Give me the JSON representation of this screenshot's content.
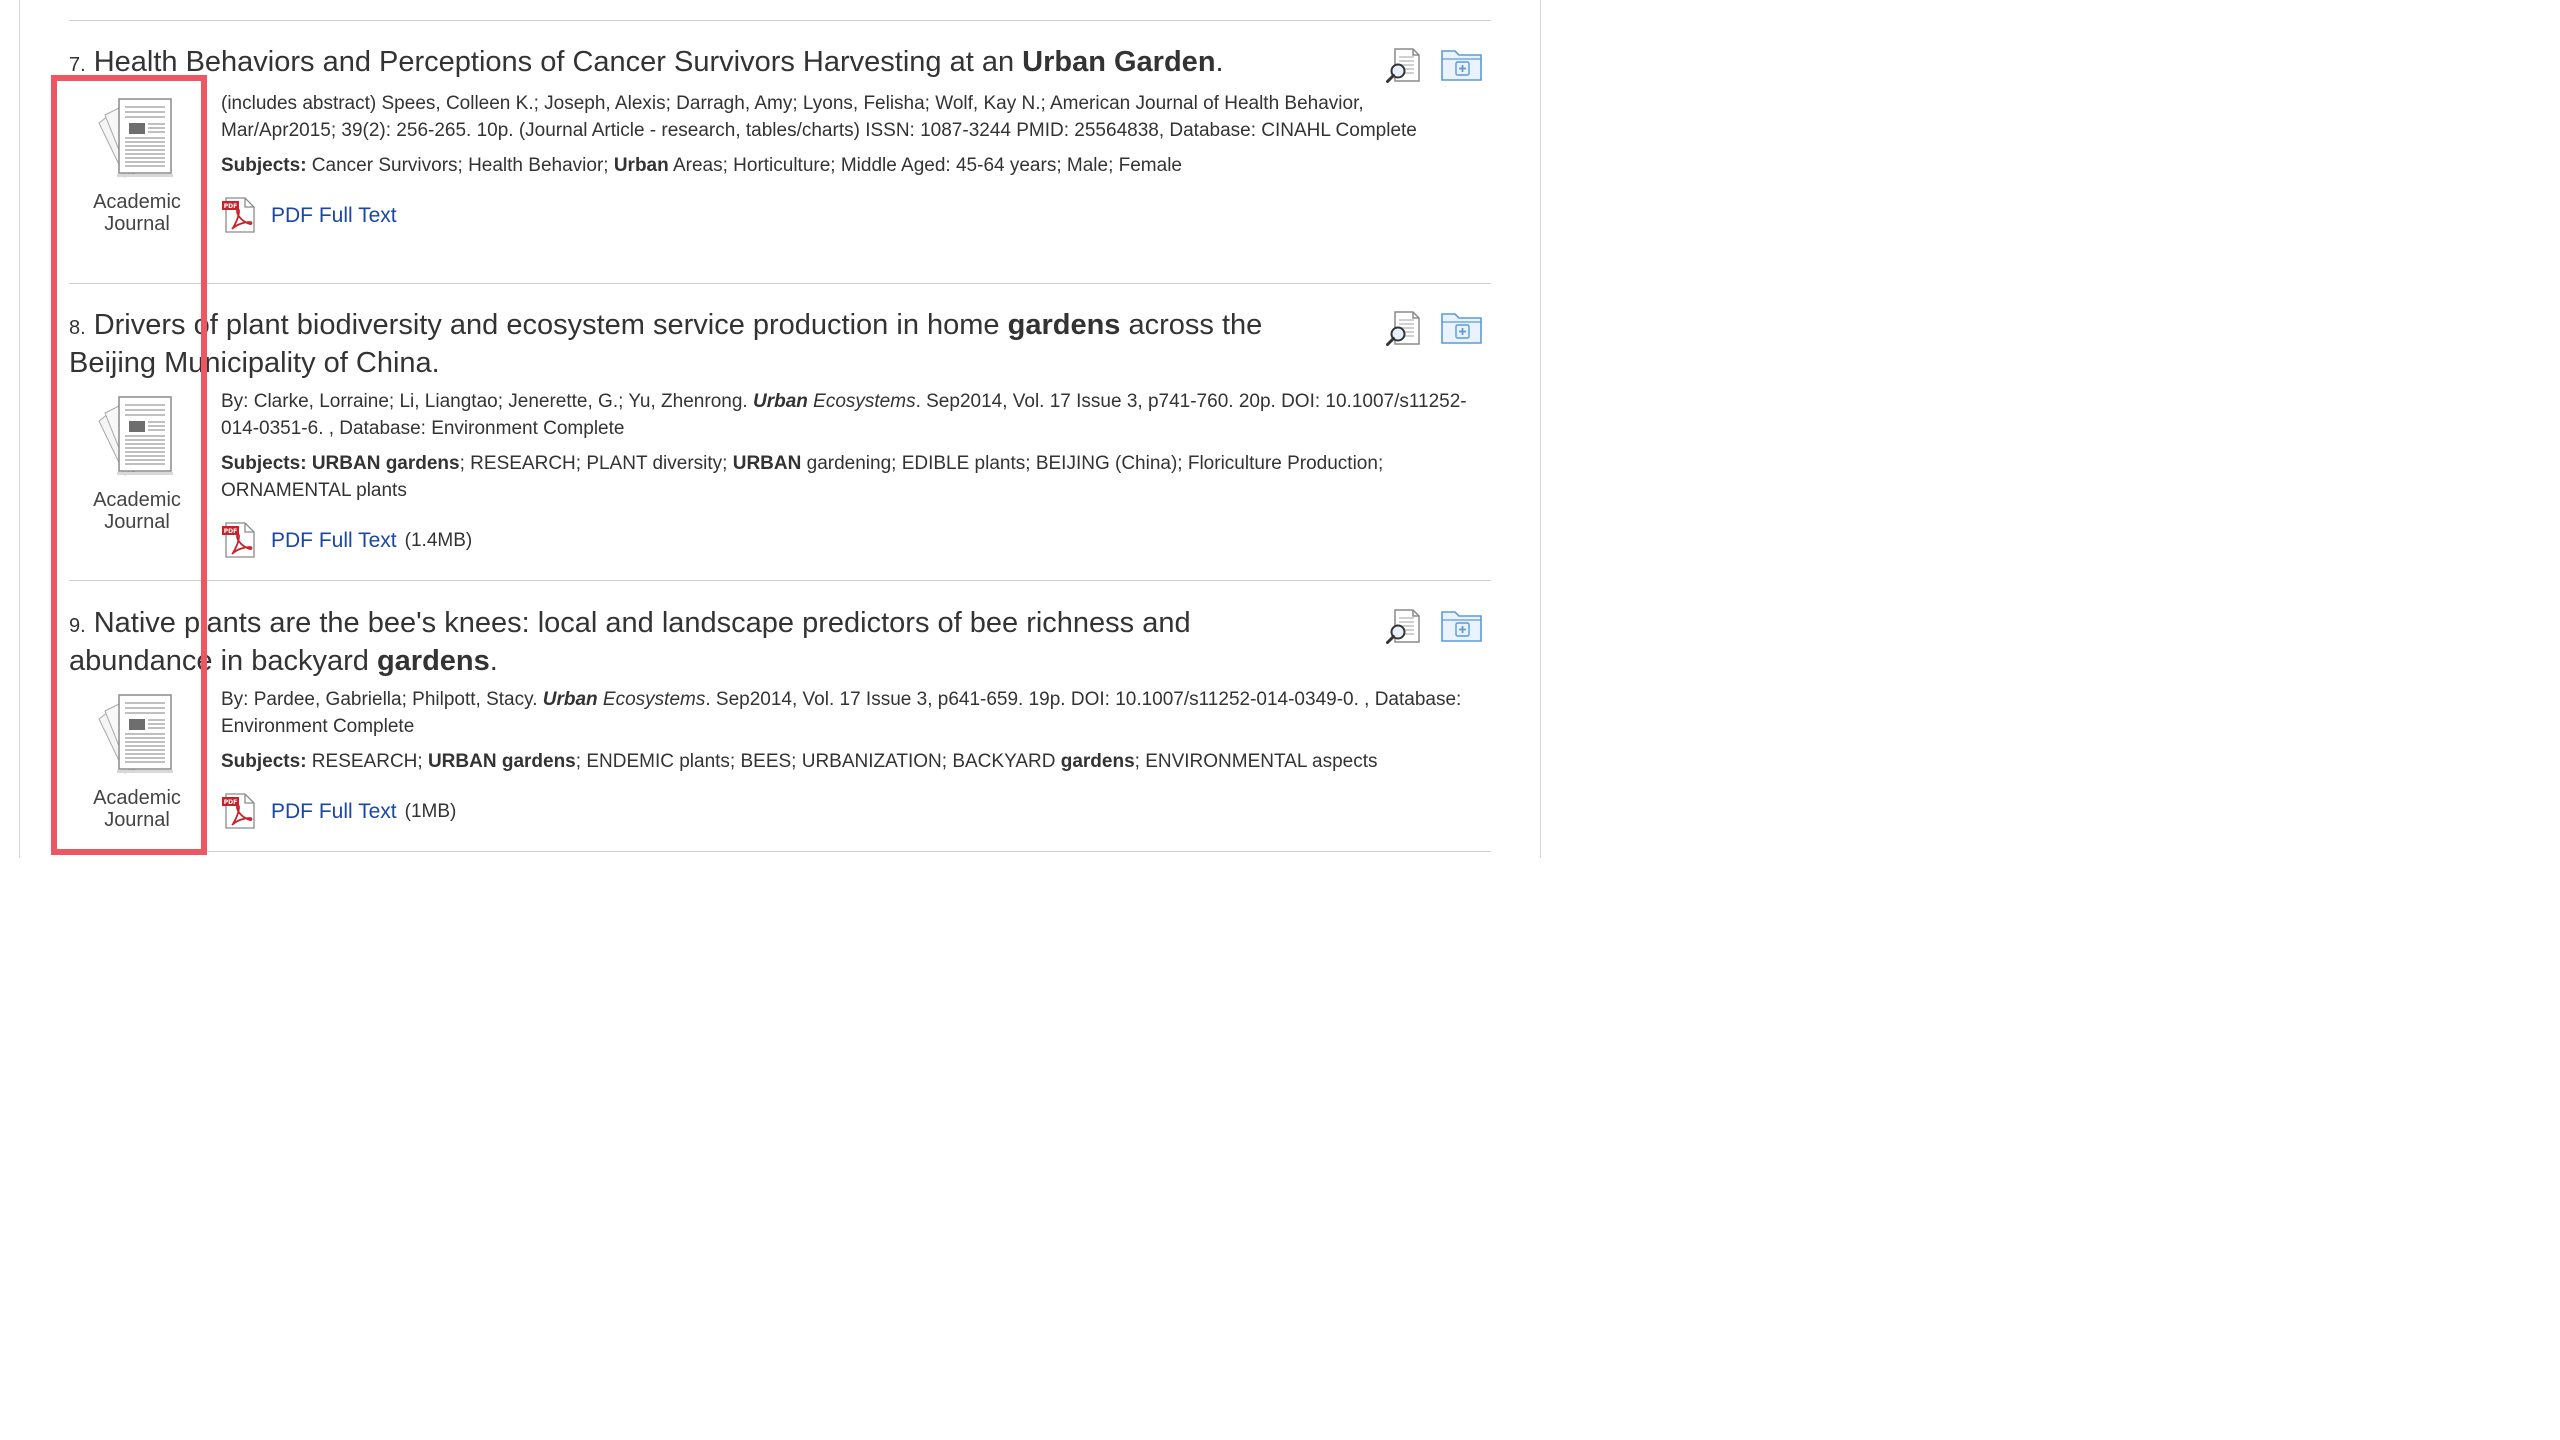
{
  "results": [
    {
      "number": "7.",
      "title_parts": [
        "Health Behaviors and Perceptions of Cancer Survivors Harvesting at an ",
        "Urban Garden",
        "."
      ],
      "publication_type": "Academic Journal",
      "citation": {
        "text": "(includes abstract) Spees, Colleen K.; Joseph, Alexis; Darragh, Amy; Lyons, Felisha; Wolf, Kay N.; American Journal of Health Behavior, Mar/Apr2015; 39(2): 256-265. 10p. (Journal Article - research, tables/charts) ISSN: 1087-3244 PMID: 25564838, Database: CINAHL Complete"
      },
      "subjects_label": "Subjects:",
      "subjects": [
        {
          "text": " Cancer Survivors; Health Behavior; ",
          "bold": false
        },
        {
          "text": "Urban",
          "bold": true
        },
        {
          "text": " Areas; Horticulture; Middle Aged: 45-64 years; Male; Female",
          "bold": false
        }
      ],
      "link_label": "PDF Full Text",
      "link_size": ""
    },
    {
      "number": "8.",
      "title_parts": [
        "Drivers of plant biodiversity and ecosystem service production in home ",
        "gardens",
        " across the Beijing Municipality of China."
      ],
      "publication_type": "Academic Journal",
      "citation": {
        "prefix": "By: Clarke, Lorraine; Li, Liangtao; Jenerette, G.; Yu, Zhenrong. ",
        "journal_bold": "Urban",
        "journal_rest": " Ecosystems",
        "suffix": ". Sep2014, Vol. 17 Issue 3, p741-760. 20p. DOI: 10.1007/s11252-014-0351-6. , Database: Environment Complete"
      },
      "subjects_label": "Subjects:",
      "subjects": [
        {
          "text": " ",
          "bold": false
        },
        {
          "text": "URBAN gardens",
          "bold": true
        },
        {
          "text": "; RESEARCH; PLANT diversity; ",
          "bold": false
        },
        {
          "text": "URBAN",
          "bold": true
        },
        {
          "text": " gardening; EDIBLE plants; BEIJING (China); Floriculture Production; ORNAMENTAL plants",
          "bold": false
        }
      ],
      "link_label": "PDF Full Text",
      "link_size": "(1.4MB)"
    },
    {
      "number": "9.",
      "title_parts": [
        "Native plants are the bee's knees: local and landscape predictors of bee richness and abundance in backyard ",
        "gardens",
        "."
      ],
      "publication_type": "Academic Journal",
      "citation": {
        "prefix": "By: Pardee, Gabriella; Philpott, Stacy. ",
        "journal_bold": "Urban",
        "journal_rest": " Ecosystems",
        "suffix": ". Sep2014, Vol. 17 Issue 3, p641-659. 19p. DOI: 10.1007/s11252-014-0349-0. , Database: Environment Complete"
      },
      "subjects_label": "Subjects:",
      "subjects": [
        {
          "text": " RESEARCH; ",
          "bold": false
        },
        {
          "text": "URBAN gardens",
          "bold": true
        },
        {
          "text": "; ENDEMIC plants; BEES; URBANIZATION; BACKYARD ",
          "bold": false
        },
        {
          "text": "gardens",
          "bold": true
        },
        {
          "text": "; ENVIRONMENTAL aspects",
          "bold": false
        }
      ],
      "link_label": "PDF Full Text",
      "link_size": "(1MB)"
    }
  ],
  "icons": {
    "preview": "magnifier-page-icon",
    "folder": "add-to-folder-icon",
    "pdf": "pdf-icon",
    "journal": "academic-journal-icon"
  },
  "colors": {
    "link": "#1a46a8",
    "highlight": "#ee5761",
    "folder": "#5a9bd8"
  }
}
